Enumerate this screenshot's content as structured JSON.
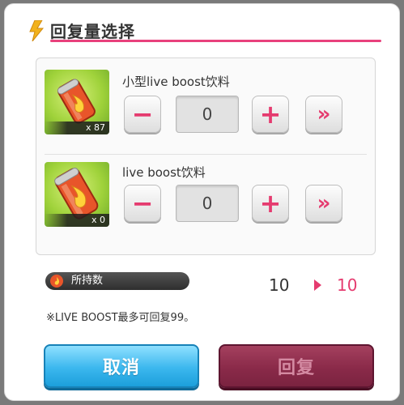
{
  "dialog": {
    "title": "回复量选择"
  },
  "items": [
    {
      "name": "小型live boost饮料",
      "count": "x 87",
      "quantity": "0"
    },
    {
      "name": "live boost饮料",
      "count": "x 0",
      "quantity": "0"
    }
  ],
  "controls": {
    "minus": "−",
    "plus": "+",
    "max": "»"
  },
  "owned": {
    "label": "所持数",
    "current": "10",
    "after": "10"
  },
  "note": "※LIVE BOOST最多可回复99。",
  "buttons": {
    "cancel": "取消",
    "confirm": "回复"
  },
  "colors": {
    "accent": "#e53b6f",
    "cancel": "#3bb7ee",
    "confirm": "#8a2a49"
  },
  "icons": {
    "title": "lightning-icon",
    "owned": "flame-icon",
    "item": "drink-can-icon"
  }
}
